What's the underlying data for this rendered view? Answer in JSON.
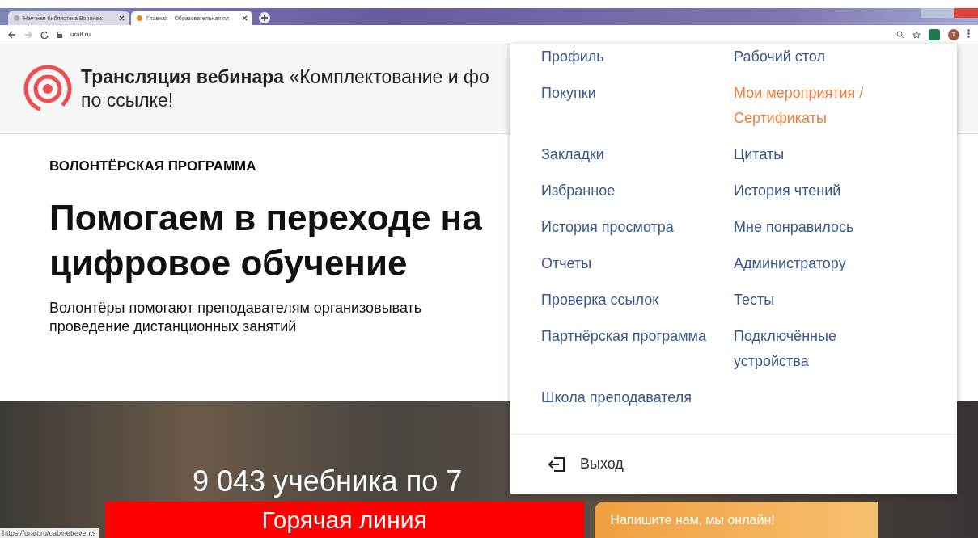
{
  "browser": {
    "tabs": [
      {
        "title": "Научная библиотека Воронеж",
        "selected": false
      },
      {
        "title": "Главная – Образовательная пл",
        "selected": true
      }
    ],
    "url": "urait.ru",
    "profile_initial": "T"
  },
  "banner": {
    "bold": "Трансляция вебинара",
    "text": " «Комплектование и фо",
    "text2": "по ссылке!"
  },
  "hero": {
    "eyebrow": "ВОЛОНТЁРСКАЯ ПРОГРАММА",
    "title": "Помогаем в переходе на цифровое обучение",
    "text": "Волонтёры помогают преподавателям организовывать проведение дистанционных занятий"
  },
  "books": {
    "caption": "9 043 учебника по 7"
  },
  "hotline": "Горячая линия",
  "chat": "Напишите нам, мы онлайн!",
  "status_url": "https://urait.ru/cabinet/events",
  "menu": {
    "rows": [
      {
        "left": {
          "label": "Профиль",
          "selected": false
        },
        "right": {
          "label": "Рабочий стол",
          "selected": false
        }
      },
      {
        "left": {
          "label": "Покупки",
          "selected": false
        },
        "right": {
          "label": "Мои мероприятия / Сертификаты",
          "selected": true
        }
      },
      {
        "left": {
          "label": "Закладки",
          "selected": false
        },
        "right": {
          "label": "Цитаты",
          "selected": false
        }
      },
      {
        "left": {
          "label": "Избранное",
          "selected": false
        },
        "right": {
          "label": "История чтений",
          "selected": false
        }
      },
      {
        "left": {
          "label": "История просмотра",
          "selected": false
        },
        "right": {
          "label": "Мне понравилось",
          "selected": false
        }
      },
      {
        "left": {
          "label": "Отчеты",
          "selected": false
        },
        "right": {
          "label": "Администратору",
          "selected": false
        }
      },
      {
        "left": {
          "label": "Проверка ссылок",
          "selected": false
        },
        "right": {
          "label": "Тесты",
          "selected": false
        }
      },
      {
        "left": {
          "label": "Партнёрская программа",
          "selected": false
        },
        "right": {
          "label": "Подключённые устройства",
          "selected": false
        }
      },
      {
        "left": {
          "label": "Школа преподавателя",
          "selected": false
        }
      }
    ],
    "logout": "Выход"
  }
}
